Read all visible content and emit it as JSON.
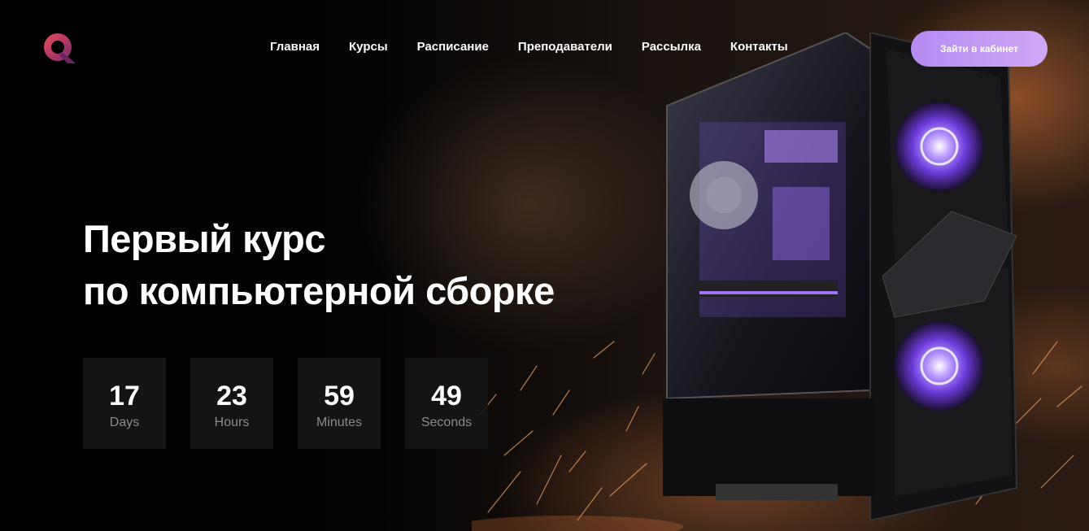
{
  "brand": {
    "logo_icon": "q-logo-icon",
    "colors": {
      "logo_start": "#e2455a",
      "logo_end": "#8a2d6e",
      "accent": "#c39cf5"
    }
  },
  "nav": {
    "items": [
      {
        "label": "Главная"
      },
      {
        "label": "Курсы"
      },
      {
        "label": "Расписание"
      },
      {
        "label": "Преподаватели"
      },
      {
        "label": "Рассылка"
      },
      {
        "label": "Контакты"
      }
    ],
    "login_label": "Зайти в кабинет"
  },
  "hero": {
    "title_line1": "Первый курс",
    "title_line2": "по компьютерной сборке"
  },
  "countdown": [
    {
      "value": "17",
      "label": "Days"
    },
    {
      "value": "23",
      "label": "Hours"
    },
    {
      "value": "59",
      "label": "Minutes"
    },
    {
      "value": "49",
      "label": "Seconds"
    }
  ]
}
